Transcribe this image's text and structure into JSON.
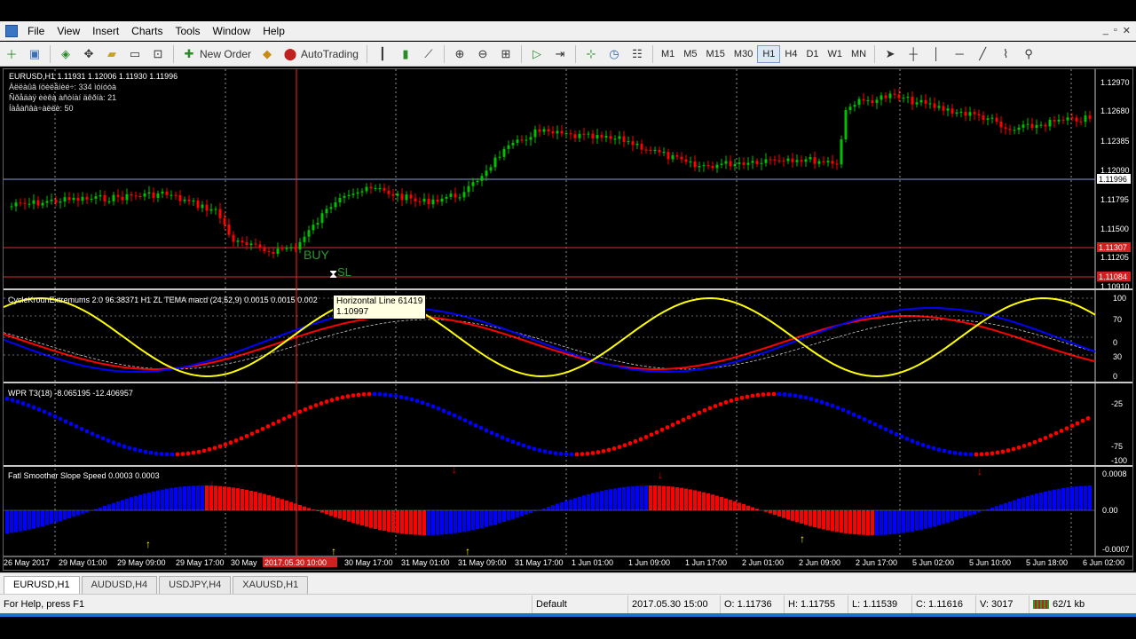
{
  "menu": [
    "File",
    "View",
    "Insert",
    "Charts",
    "Tools",
    "Window",
    "Help"
  ],
  "window_controls": [
    "_",
    "▫",
    "✕"
  ],
  "toolbar": {
    "new_order": "New Order",
    "autotrading": "AutoTrading",
    "timeframes": [
      "M1",
      "M5",
      "M15",
      "M30",
      "H1",
      "H4",
      "D1",
      "W1",
      "MN"
    ],
    "active_timeframe": "H1"
  },
  "chart": {
    "symbol_header": "EURUSD,H1  1.11931 1.12006 1.11930 1.11996",
    "info_lines": [
      "Àëëàûâ íöèëåíèé÷: 334 ìóíóòà",
      "Ñðåäàÿ èèêà àñòíàí äêðíà: 21",
      "Íàåàñâà÷àëèè: 50"
    ],
    "price_ticks": [
      "1.12970",
      "1.12680",
      "1.12385",
      "1.12090",
      "1.11996",
      "1.11795",
      "1.11500",
      "1.11307",
      "1.11205",
      "1.11084",
      "1.10910"
    ],
    "current_price": "1.11996",
    "buy_label": "BUY",
    "sl_label": "SL",
    "tooltip_line1": "Horizontal Line 61419",
    "tooltip_line2": "1.10997",
    "colors": {
      "bull": "#00c000",
      "bear": "#ff0000",
      "yellow": "#ffff00",
      "blue": "#0000ff",
      "red": "#ff0000"
    }
  },
  "indicators": [
    {
      "title": "CycleKrounExtremums 2.0 96.38371  H1 ZL TEMA macd (24,52,9) 0.0015 0.0015 0.002",
      "ticks": [
        "100",
        "70",
        "0",
        "30",
        "0"
      ]
    },
    {
      "title": "WPR T3(18) -8.065195 -12.406957",
      "ticks": [
        "-25",
        "-75",
        "-100"
      ]
    },
    {
      "title": "Fatl Smoother Slope Speed 0.0003 0.0003",
      "ticks": [
        "0.0008",
        "0.00",
        "-0.0007"
      ]
    }
  ],
  "time_axis": [
    "26 May 2017",
    "29 May 01:00",
    "29 May 09:00",
    "29 May 17:00",
    "30 May",
    "2017.05.30 10:00",
    "30 May 17:00",
    "31 May 01:00",
    "31 May 09:00",
    "31 May 17:00",
    "1 Jun 01:00",
    "1 Jun 09:00",
    "1 Jun 17:00",
    "2 Jun 01:00",
    "2 Jun 09:00",
    "2 Jun 17:00",
    "5 Jun 02:00",
    "5 Jun 10:00",
    "5 Jun 18:00",
    "6 Jun 02:00"
  ],
  "symbol_tabs": [
    "EURUSD,H1",
    "AUDUSD,H4",
    "USDJPY,H4",
    "XAUUSD,H1"
  ],
  "status": {
    "help": "For Help, press F1",
    "profile": "Default",
    "datetime": "2017.05.30 15:00",
    "open": "O: 1.11736",
    "high": "H: 1.11755",
    "low": "L: 1.11539",
    "close": "C: 1.11616",
    "volume": "V: 3017",
    "connection": "62/1 kb"
  }
}
